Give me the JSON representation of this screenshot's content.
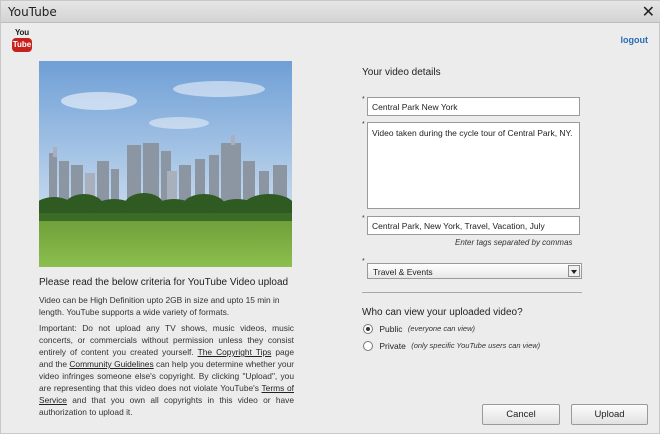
{
  "window": {
    "title": "YouTube",
    "close_glyph": "✕"
  },
  "logo": {
    "you": "You",
    "tube": "Tube"
  },
  "header": {
    "logout_label": "logout"
  },
  "left": {
    "criteria_title": "Please read the below criteria for YouTube Video upload",
    "para1": "Video can be High Definition upto 2GB in size and upto 15 min in length. YouTube supports a wide variety of formats.",
    "para2_a": "Important: Do not upload any TV shows, music videos, music concerts, or commercials without permission unless they consist entirely of content you created yourself.",
    "para2_link1": "The Copyright Tips",
    "para2_b": "page and the",
    "para2_link2": "Community Guidelines",
    "para2_c": "can help you determine whether your video infringes someone else's copyright. By clicking \"Upload\", you are representing that this video does not violate YouTube's",
    "para2_link3": "Terms of Service",
    "para2_d": "and that you own all copyrights in this video or have authorization to upload it."
  },
  "details": {
    "title": "Your video details",
    "required_mark": "*",
    "video_title_value": "Central Park New York",
    "description_value": "Video taken during the cycle tour of Central Park, NY.",
    "tags_value": "Central Park, New York, Travel, Vacation, July",
    "tags_hint": "Enter tags separated by commas",
    "category_selected": "Travel & Events"
  },
  "privacy": {
    "title": "Who can view your uploaded video?",
    "options": [
      {
        "label": "Public",
        "note": "(everyone can view)",
        "checked": true
      },
      {
        "label": "Private",
        "note": "(only specific YouTube users can view)",
        "checked": false
      }
    ]
  },
  "buttons": {
    "cancel": "Cancel",
    "upload": "Upload"
  },
  "colors": {
    "accent_link": "#2b6cb5",
    "logo_red": "#c8201c",
    "window_bg": "#ececec"
  }
}
